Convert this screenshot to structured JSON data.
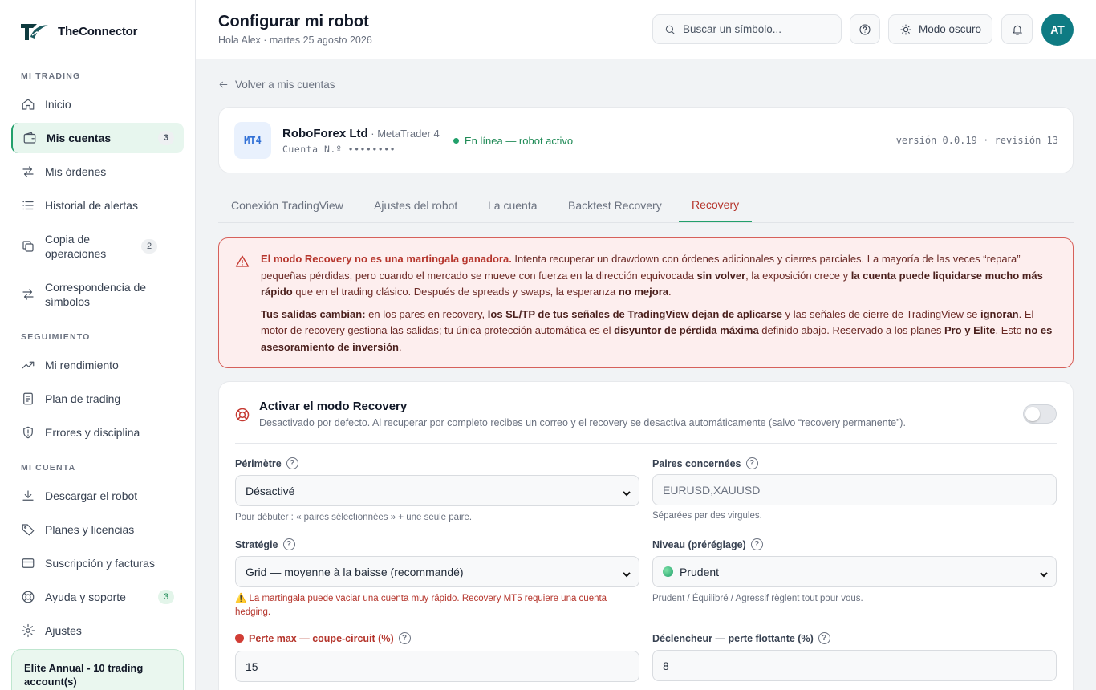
{
  "brand": {
    "name": "TheConnector"
  },
  "sidebar": {
    "sections": [
      "MI TRADING",
      "SEGUIMIENTO",
      "MI CUENTA"
    ],
    "items": [
      {
        "label": "Inicio",
        "icon": "home-icon"
      },
      {
        "label": "Mis cuentas",
        "icon": "wallet-icon",
        "badge": "3"
      },
      {
        "label": "Mis órdenes",
        "icon": "arrows-icon"
      },
      {
        "label": "Historial de alertas",
        "icon": "list-icon"
      },
      {
        "label": "Copia de operaciones",
        "icon": "copy-icon",
        "badge": "2"
      },
      {
        "label": "Correspondencia de símbolos",
        "icon": "swap-icon"
      },
      {
        "label": "Mi rendimiento",
        "icon": "trend-icon"
      },
      {
        "label": "Plan de trading",
        "icon": "notebook-icon"
      },
      {
        "label": "Errores y disciplina",
        "icon": "shield-icon"
      },
      {
        "label": "Descargar el robot",
        "icon": "download-icon"
      },
      {
        "label": "Planes y licencias",
        "icon": "tag-icon"
      },
      {
        "label": "Suscripción y facturas",
        "icon": "card-icon"
      },
      {
        "label": "Ayuda y soporte",
        "icon": "lifebuoy-icon",
        "badge": "3"
      },
      {
        "label": "Ajustes",
        "icon": "gear-icon"
      }
    ],
    "plan": "Elite Annual - 10 trading account(s)"
  },
  "header": {
    "title": "Configurar mi robot",
    "subtitle": "Hola Alex · martes 25 agosto 2026",
    "search_placeholder": "Buscar un símbolo...",
    "dark_mode": "Modo oscuro",
    "avatar": "AT"
  },
  "back": "Volver a mis cuentas",
  "account": {
    "badge": "MT4",
    "broker": "RoboForex Ltd",
    "platform": " · MetaTrader 4",
    "number": "Cuenta N.º ••••••••",
    "status": "En línea — robot activo",
    "version": "versión 0.0.19 · revisión 13"
  },
  "tabs": [
    "Conexión TradingView",
    "Ajustes del robot",
    "La cuenta",
    "Backtest Recovery",
    "Recovery"
  ],
  "warning": {
    "p1_a": "El modo Recovery no es una martingala ganadora.",
    "p1_b": " Intenta recuperar un drawdown con órdenes adicionales y cierres parciales. La mayoría de las veces “repara” pequeñas pérdidas, pero cuando el mercado se mueve con fuerza en la dirección equivocada ",
    "p1_c": "sin volver",
    "p1_d": ", la exposición crece y ",
    "p1_e": "la cuenta puede liquidarse mucho más rápido",
    "p1_f": " que en el trading clásico. Después de spreads y swaps, la esperanza ",
    "p1_g": "no mejora",
    "p1_h": ".",
    "p2_a": "Tus salidas cambian:",
    "p2_b": " en los pares en recovery, ",
    "p2_c": "los SL/TP de tus señales de TradingView dejan de aplicarse",
    "p2_d": " y las señales de cierre de TradingView se ",
    "p2_e": "ignoran",
    "p2_f": ". El motor de recovery gestiona las salidas; tu única protección automática es el ",
    "p2_g": "disyuntor de pérdida máxima",
    "p2_h": " definido abajo. Reservado a los planes ",
    "p2_i": "Pro y Elite",
    "p2_j": ". Esto ",
    "p2_k": "no es asesoramiento de inversión",
    "p2_l": "."
  },
  "recovery": {
    "title": "Activar el modo Recovery",
    "desc": "Desactivado por defecto. Al recuperar por completo recibes un correo y el recovery se desactiva automáticamente (salvo “recovery permanente”).",
    "enabled": false
  },
  "fields": {
    "perimetre": {
      "label": "Périmètre",
      "value": "Désactivé",
      "hint": "Pour débuter : « paires sélectionnées » + une seule paire."
    },
    "paires": {
      "label": "Paires concernées",
      "placeholder": "EURUSD,XAUUSD",
      "hint": "Séparées par des virgules."
    },
    "strategie": {
      "label": "Stratégie",
      "value": "Grid — moyenne à la baisse (recommandé)",
      "hint": "⚠️ La martingala puede vaciar una cuenta muy rápido. Recovery MT5 requiere una cuenta hedging."
    },
    "niveau": {
      "label": "Niveau (préréglage)",
      "value": "Prudent",
      "hint": "Prudent / Équilibré / Agressif règlent tout pour vous."
    },
    "perte_max": {
      "label": "Perte max — coupe-circuit (%)",
      "value": "15"
    },
    "declencheur": {
      "label": "Déclencheur — perte flottante (%)",
      "value": "8"
    }
  }
}
